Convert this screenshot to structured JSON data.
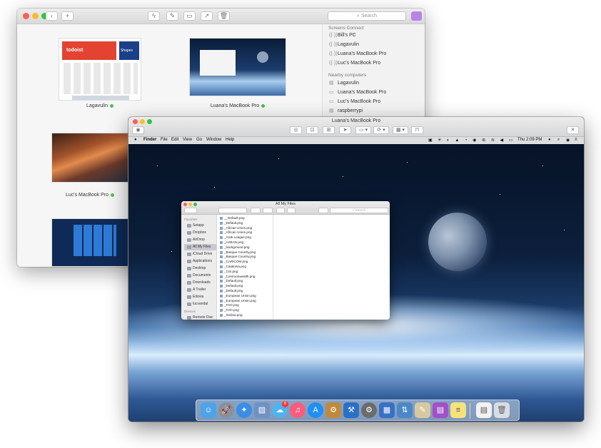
{
  "back_window": {
    "search_placeholder": "Search",
    "screens_connect_header": "Screens Connect",
    "screens_connect_items": [
      "Bill's PC",
      "Lagavulin",
      "Luana's MacBook Pro",
      "Luc's MacBook Pro"
    ],
    "nearby_header": "Nearby computers",
    "nearby_items": [
      "Lagavulin",
      "Luana's MacBook Pro",
      "Luc's MacBook Pro",
      "raspberrypi"
    ],
    "thumbnails": [
      {
        "label": "Lagavulin",
        "thumb_text": "todoist",
        "thumb_text_2": "Shapes"
      },
      {
        "label": "Luana's MacBook Pro"
      },
      {
        "label": "Luc's MacBook Pro"
      },
      {
        "label": ""
      }
    ]
  },
  "front_window": {
    "title": "Luana's MacBook Pro",
    "menubar": {
      "app_name": "Finder",
      "menus": [
        "File",
        "Edit",
        "View",
        "Go",
        "Window",
        "Help"
      ],
      "clock": "Thu 2:09 PM"
    },
    "finder": {
      "title": "All My Files",
      "search_placeholder": "Search",
      "favorites_header": "Favorites",
      "devices_header": "Devices",
      "sidebar_items": [
        "Setapp",
        "Dropbox",
        "AirDrop",
        "All My Files",
        "iCloud Drive",
        "Applications",
        "Desktop",
        "Documents",
        "Downloads",
        "A Trailer",
        "Edovia",
        "lucvandal"
      ],
      "device_items": [
        "Remote Disc"
      ],
      "files": [
        "__Default.png",
        "_Default.png",
        "_African Union.png",
        "_African Union.png",
        "_Arab League.png",
        "_ASEAN.png",
        "_background.png",
        "_Basque Country.png",
        "_Basque Country.png",
        "_CARICOM.png",
        "_Catalonia.png",
        "_CIS.png",
        "_Commonwealth.png",
        "_Default.png",
        "_Default.png",
        "_Default.png",
        "_European Union.png",
        "_European Union.png",
        "_FAO.png",
        "_FAO.png",
        "_Galicia.png"
      ]
    },
    "dock_icons": [
      "finder-icon",
      "launchpad-icon",
      "safari-icon",
      "preview-icon",
      "messages-icon",
      "itunes-icon",
      "app-store-icon",
      "automator-icon",
      "xcode-icon",
      "system-preferences-icon",
      "screens-icon",
      "transmit-icon",
      "sketchbook-icon",
      "stacks-icon",
      "notes-icon",
      "documents-icon",
      "trash-icon"
    ],
    "messages_badge": "6"
  }
}
